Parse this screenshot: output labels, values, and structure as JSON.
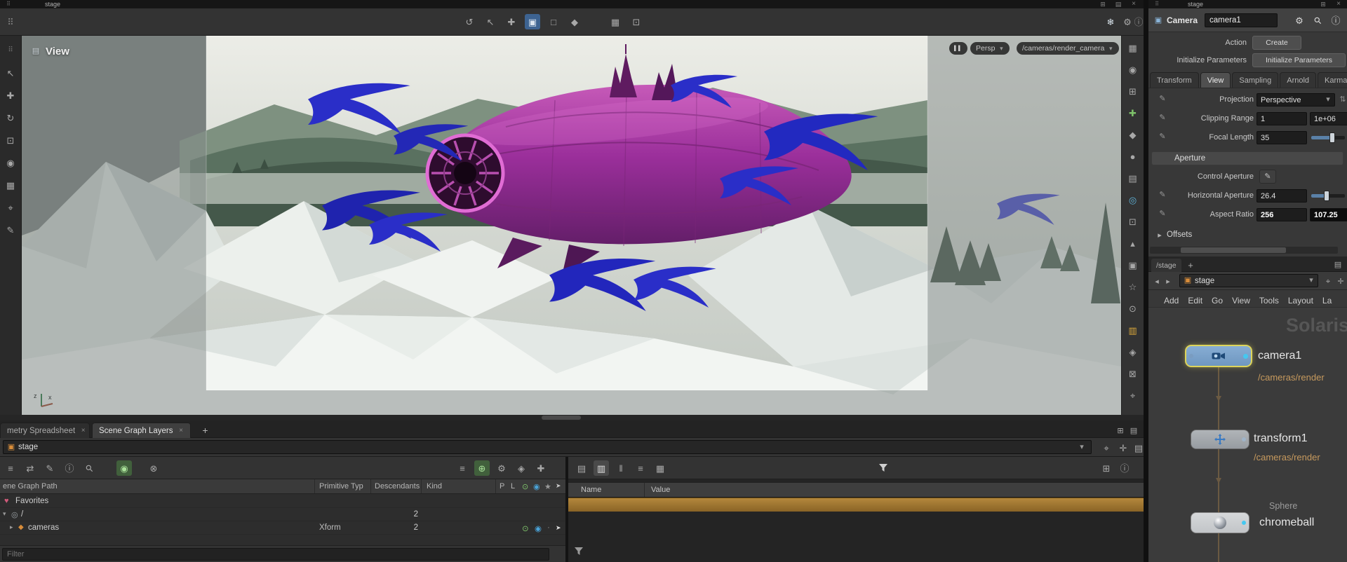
{
  "titlebar": {
    "left_title": "stage",
    "right_title": "stage"
  },
  "icons": {
    "hamburger": "⠿",
    "snowflake": "❄",
    "gear": "⚙",
    "info": "ⓘ",
    "pause": "▌▌",
    "caret_down": "▾",
    "caret_right": "▸",
    "caret_left": "◂",
    "pin": "⌖",
    "target": "✛",
    "spinner": "⇅",
    "pane_menu": "▤",
    "plus": "+",
    "close": "×",
    "heart": "♥",
    "power": "⊙",
    "dot": "◉",
    "bullet": "·",
    "star": "★",
    "cursor": "➤",
    "grid": "⊞",
    "menu": "≡",
    "pencil": "✎",
    "search": "⚲",
    "node_box": "▣",
    "globe": "◎",
    "prim": "◆"
  },
  "strips": {
    "viewport_toolbar": [
      "↺",
      "↖",
      "✚",
      "▣",
      "□",
      "◆",
      "▦",
      "⊡"
    ],
    "left": [
      "⠿",
      "↖",
      "✚",
      "↻",
      "⊡",
      "◉",
      "▦",
      "⌖",
      "✎"
    ],
    "right": [
      "▦",
      "◉",
      "⊞",
      "✚",
      "◆",
      "●",
      "▤",
      "◎",
      "⊡",
      "▴",
      "▣",
      "☆",
      "⊙",
      "▥",
      "◈",
      "⊠",
      "⌖"
    ],
    "sg_left": [
      "≡",
      "⇄",
      "✎",
      "ⓘ",
      "⚲",
      "◉",
      "⊗"
    ],
    "sg_right": [
      "≡",
      "⊕",
      "⚙",
      "◈",
      "✚"
    ],
    "vt_left": [
      "▤",
      "▥",
      "‖",
      "≡",
      "▦"
    ]
  },
  "viewport": {
    "pane_label": "View",
    "persp_label": "Persp",
    "camera_path": "/cameras/render_camera",
    "axis_z": "z",
    "axis_x": "x"
  },
  "params": {
    "node_type": "Camera",
    "node_name": "camera1",
    "action_label": "Action",
    "create_button": "Create",
    "initialize_label": "Initialize Parameters",
    "initialize_button": "Initialize Parameters",
    "tabs": [
      "Transform",
      "View",
      "Sampling",
      "Arnold",
      "Karma"
    ],
    "projection_label": "Projection",
    "projection_value": "Perspective",
    "clipping_label": "Clipping Range",
    "clipping_near": "1",
    "clipping_far": "1e+06",
    "focal_label": "Focal Length",
    "focal_value": "35",
    "aperture_section": "Aperture",
    "control_aperture_label": "Control Aperture",
    "horizontal_aperture_label": "Horizontal Aperture",
    "horizontal_aperture_value": "26.4",
    "aspect_label": "Aspect Ratio",
    "aspect_value": "256",
    "aspect_value2": "107.25",
    "offsets_section": "Offsets"
  },
  "network": {
    "path_tab": "/stage",
    "node_selector_value": "stage",
    "menus": [
      "Add",
      "Edit",
      "Go",
      "View",
      "Tools",
      "Layout",
      "La"
    ],
    "watermark": "Solaris",
    "camera_node_name": "camera1",
    "camera_node_path": "/cameras/render",
    "transform_node_name": "transform1",
    "transform_node_path": "/cameras/render",
    "sphere_node_type": "Sphere",
    "sphere_node_name": "chromeball"
  },
  "bottom": {
    "tab1": "metry Spreadsheet",
    "tab2": "Scene Graph Layers",
    "path_value": "stage",
    "sg": {
      "col_path": "ene Graph Path",
      "col_type": "Primitive Typ",
      "col_desc": "Descendants",
      "col_kind": "Kind",
      "col_p": "P",
      "col_l": "L",
      "row_favorites": "Favorites",
      "row_root": "/",
      "row_root_desc": "2",
      "row_cameras": "cameras",
      "row_cameras_type": "Xform",
      "row_cameras_desc": "2",
      "filter_label": "Filter"
    },
    "vt": {
      "col_name": "Name",
      "col_value": "Value"
    }
  },
  "colors": {
    "selection_yellow": "#ddd45a",
    "node_path_orange": "#c79a5e",
    "selected_row_gold": "#a8803a",
    "ship_magenta": "#99309a",
    "bird_blue": "#2a2ec8"
  }
}
